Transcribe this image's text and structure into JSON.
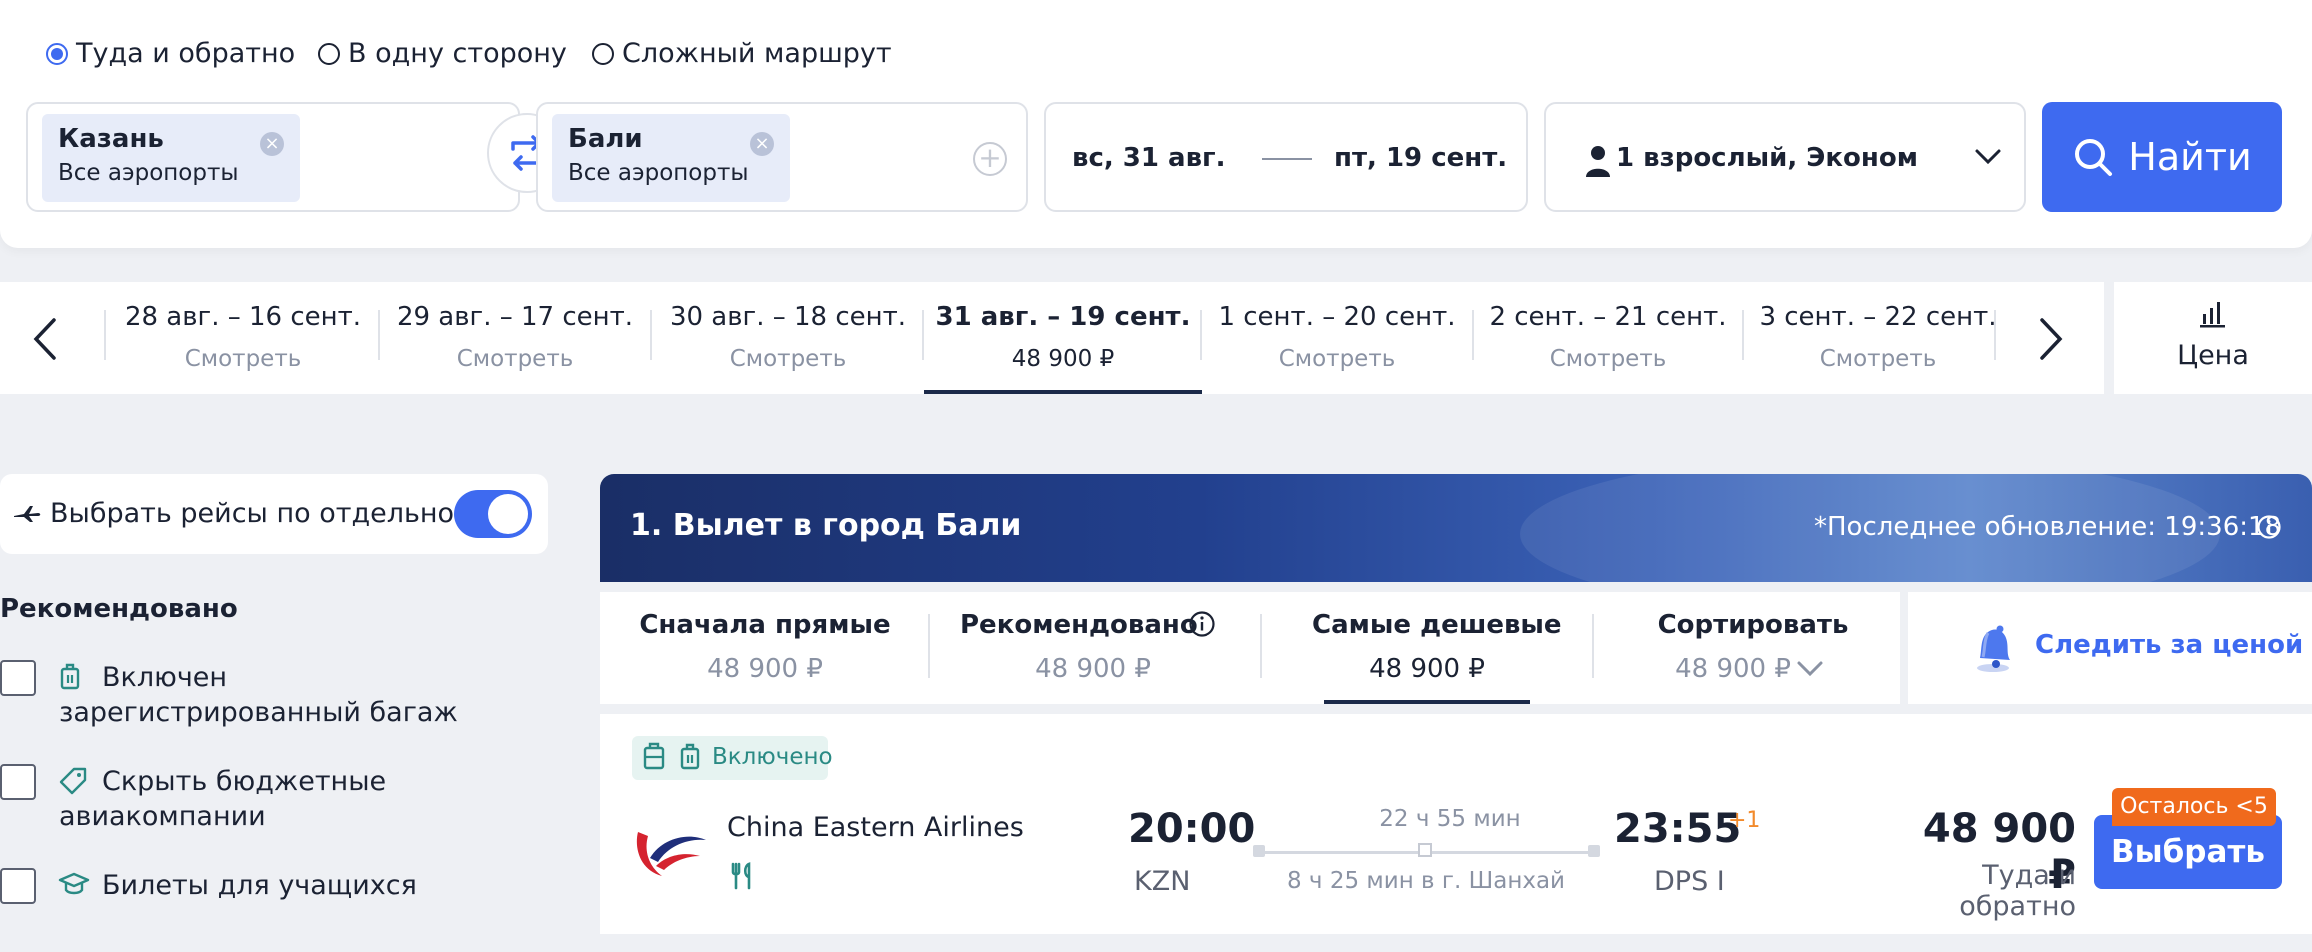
{
  "trip_type": {
    "options": [
      {
        "label": "Туда и обратно",
        "selected": true
      },
      {
        "label": "В одну сторону",
        "selected": false
      },
      {
        "label": "Сложный маршрут",
        "selected": false
      }
    ]
  },
  "search": {
    "origin": {
      "city": "Казань",
      "airports": "Все аэропорты"
    },
    "destination": {
      "city": "Бали",
      "airports": "Все аэропорты"
    },
    "date_from": "вс, 31 авг.",
    "date_to": "пт, 19 сент.",
    "passengers": "1 взрослый, Эконом",
    "search_button": "Найти"
  },
  "date_strip": {
    "cells": [
      {
        "range": "28 авг. – 16 сент.",
        "sub": "Смотреть"
      },
      {
        "range": "29 авг. – 17 сент.",
        "sub": "Смотреть"
      },
      {
        "range": "30 авг. – 18 сент.",
        "sub": "Смотреть"
      },
      {
        "range": "31 авг. – 19 сент.",
        "sub": "48 900 ₽",
        "active": true
      },
      {
        "range": "1 сент. – 20 сент.",
        "sub": "Смотреть"
      },
      {
        "range": "2 сент. – 21 сент.",
        "sub": "Смотреть"
      },
      {
        "range": "3 сент. – 22 сент.",
        "sub": "Смотреть"
      }
    ],
    "price_toggle": "Цена"
  },
  "filters": {
    "separate_flights": "Выбрать рейсы по отдельности",
    "separate_enabled": true,
    "heading": "Рекомендовано",
    "items": [
      {
        "label": "Включен зарегистрированный багаж",
        "icon": "luggage-icon"
      },
      {
        "label": "Скрыть бюджетные авиакомпании",
        "icon": "tag-icon"
      },
      {
        "label": "Билеты для учащихся",
        "icon": "graduation-cap-icon"
      }
    ]
  },
  "results": {
    "title": "1. Вылет в город Бали",
    "last_update": "*Последнее обновление: 19:36:18",
    "sort_tabs": [
      {
        "title": "Сначала прямые",
        "price": "48 900 ₽"
      },
      {
        "title": "Рекомендовано",
        "price": "48 900 ₽"
      },
      {
        "title": "Самые дешевые",
        "price": "48 900 ₽",
        "active": true
      },
      {
        "title": "Сортировать",
        "price": "48 900 ₽"
      }
    ],
    "watch_price": "Следить за ценой"
  },
  "ticket": {
    "included": "Включено",
    "airline": "China Eastern Airlines",
    "depart_time": "20:00",
    "depart_code": "KZN",
    "arrive_time": "23:55",
    "arrive_code": "DPS I",
    "plus_day": "+1",
    "duration": "22 ч 55 мин",
    "layover": "8 ч 25 мин в г. Шанхай",
    "price": "48 900 ₽",
    "price_note": "Туда и обратно",
    "seats_left": "Осталось <5",
    "select_button": "Выбрать"
  },
  "colors": {
    "accent": "#3e6af0",
    "dark_navy": "#1b2a49",
    "orange": "#f06a1c",
    "teal": "#2a8a84"
  }
}
